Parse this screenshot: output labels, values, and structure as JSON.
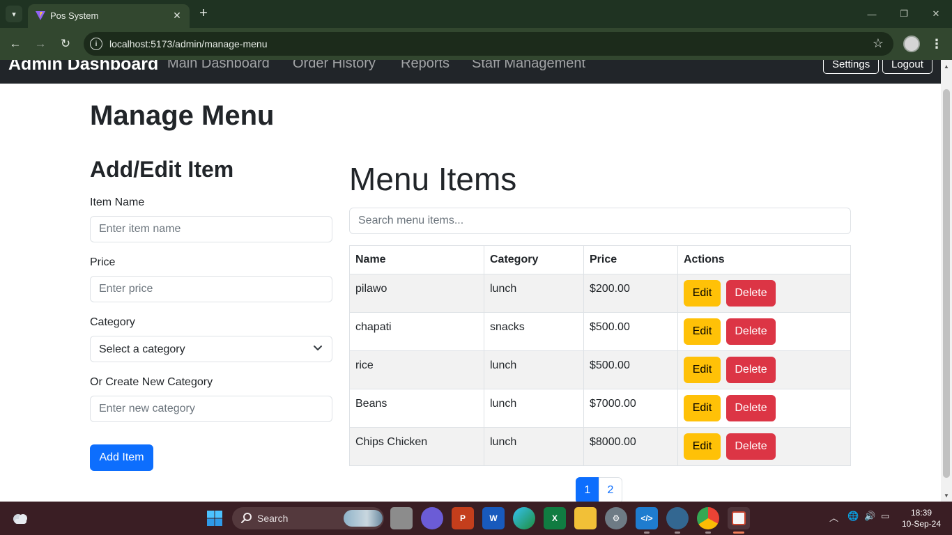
{
  "browser": {
    "tab_title": "Pos System",
    "url": "localhost:5173/admin/manage-menu"
  },
  "app_nav": {
    "brand": "Admin Dashboard",
    "links": [
      "Main Dashboard",
      "Order History",
      "Reports",
      "Staff Management"
    ],
    "settings_label": "Settings",
    "logout_label": "Logout"
  },
  "page": {
    "title": "Manage Menu"
  },
  "form": {
    "title": "Add/Edit Item",
    "item_name_label": "Item Name",
    "item_name_placeholder": "Enter item name",
    "price_label": "Price",
    "price_placeholder": "Enter price",
    "category_label": "Category",
    "category_selected": "Select a category",
    "new_category_label": "Or Create New Category",
    "new_category_placeholder": "Enter new category",
    "submit_label": "Add Item"
  },
  "menu": {
    "title": "Menu Items",
    "search_placeholder": "Search menu items...",
    "columns": [
      "Name",
      "Category",
      "Price",
      "Actions"
    ],
    "edit_label": "Edit",
    "delete_label": "Delete",
    "rows": [
      {
        "name": "pilawo",
        "category": "lunch",
        "price": "$200.00"
      },
      {
        "name": "chapati",
        "category": "snacks",
        "price": "$500.00"
      },
      {
        "name": "rice",
        "category": "lunch",
        "price": "$500.00"
      },
      {
        "name": "Beans",
        "category": "lunch",
        "price": "$7000.00"
      },
      {
        "name": "Chips Chicken",
        "category": "lunch",
        "price": "$8000.00"
      }
    ]
  },
  "pagination": {
    "pages": [
      "1",
      "2"
    ],
    "active": "1"
  },
  "taskbar": {
    "search_label": "Search",
    "time": "18:39",
    "date": "10-Sep-24"
  },
  "colors": {
    "primary": "#0d6efd",
    "warning": "#ffc107",
    "danger": "#dc3545",
    "navbar": "#212529"
  }
}
